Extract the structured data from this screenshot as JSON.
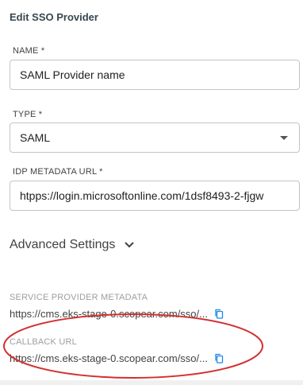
{
  "panel": {
    "title": "Edit SSO Provider"
  },
  "name_field": {
    "label": "NAME *",
    "value": "SAML Provider name"
  },
  "type_field": {
    "label": "TYPE *",
    "value": "SAML"
  },
  "idp_field": {
    "label": "IDP METADATA URL *",
    "value": "htpps://login.microsoftonline.com/1dsf8493-2-fjgw"
  },
  "advanced": {
    "label": "Advanced Settings"
  },
  "service_provider": {
    "label": "SERVICE PROVIDER METADATA",
    "value": "https://cms.eks-stage-0.scopear.com/sso/..."
  },
  "callback": {
    "label": "CALLBACK URL",
    "value": "https://cms.eks-stage-0.scopear.com/sso/..."
  },
  "colors": {
    "accent_copy": "#1e88e5",
    "annotation_ellipse": "#d32f2f"
  }
}
